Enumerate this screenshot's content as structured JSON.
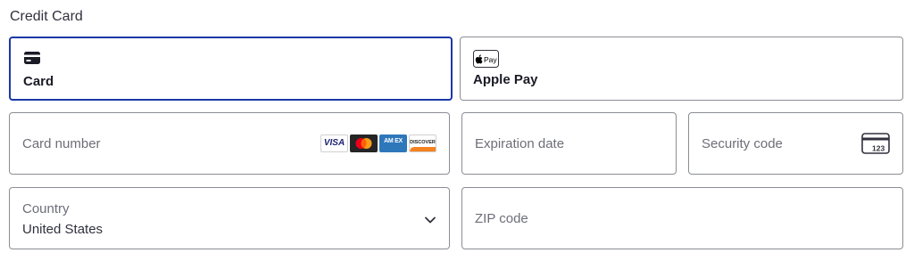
{
  "section": {
    "title": "Credit Card"
  },
  "tabs": [
    {
      "label": "Card",
      "icon": "card-icon",
      "selected": true
    },
    {
      "label": "Apple Pay",
      "icon": "apple-pay-icon",
      "icon_text": "Pay",
      "selected": false
    }
  ],
  "fields": {
    "card_number": {
      "placeholder": "Card number",
      "value": ""
    },
    "expiration": {
      "placeholder": "Expiration date",
      "value": ""
    },
    "security_code": {
      "placeholder": "Security code",
      "value": "",
      "icon": "cvc-card-icon",
      "icon_text": "123"
    },
    "country": {
      "label": "Country",
      "value": "United States",
      "icon": "chevron-down-icon"
    },
    "zip": {
      "placeholder": "ZIP code",
      "value": ""
    }
  },
  "card_brands": [
    {
      "name": "visa-logo",
      "text": "VISA"
    },
    {
      "name": "mastercard-logo",
      "text": ""
    },
    {
      "name": "amex-logo",
      "text": "AM EX"
    },
    {
      "name": "discover-logo",
      "text": "DISCOVER"
    }
  ],
  "colors": {
    "accent": "#1c38a6",
    "border": "#8a8d93",
    "text": "#30313d",
    "placeholder": "#6d6e78"
  }
}
